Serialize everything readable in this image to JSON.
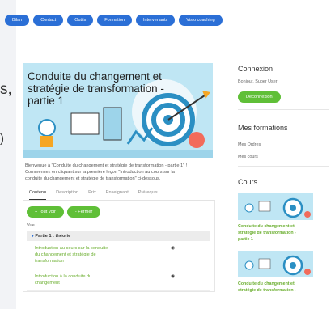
{
  "nav": {
    "items": [
      {
        "label": "Bilan"
      },
      {
        "label": "Contact"
      },
      {
        "label": "Outils"
      },
      {
        "label": "Formation"
      },
      {
        "label": "Intervenants"
      },
      {
        "label": "Visio coaching"
      }
    ]
  },
  "left_fragments": {
    "a": "s,",
    "b": ")"
  },
  "course": {
    "title_line1": "Conduite du changement et",
    "title_line2": "stratégie de transformation -",
    "title_line3": "partie 1",
    "desc_line1": "Bienvenue à \"Conduite du changement et stratégie de transformation - partie 1\" !",
    "desc_line2": "Commencez en cliquant sur la première leçon \"Introduction au cours sur la",
    "desc_line3": "conduite du changement et stratégie de transformation\" ci-dessous."
  },
  "tabs": [
    {
      "label": "Contenu",
      "active": true
    },
    {
      "label": "Description"
    },
    {
      "label": "Prix"
    },
    {
      "label": "Enseignant"
    },
    {
      "label": "Prérequis"
    }
  ],
  "buttons": {
    "expand": "+ Tout voir",
    "collapse": "- Fermer"
  },
  "panel": {
    "vue_label": "Vue",
    "part_caret": "▾",
    "part_title": "Partie 1 : théorie",
    "lessons": [
      {
        "l1": "Introduction au cours sur la conduite",
        "l2": "du changement et stratégie de",
        "l3": "transformation",
        "icon": "◉"
      },
      {
        "l1": "Introduction à la conduite du",
        "l2": "changement",
        "l3": "",
        "icon": "◉"
      }
    ]
  },
  "sidebar": {
    "connexion_title": "Connexion",
    "welcome": "Bonjour, Super User",
    "logout": "Déconnexion",
    "formations_title": "Mes formations",
    "orders": "Mes Ordres",
    "courses": "Mes cours",
    "cours_title": "Cours",
    "course_items": [
      {
        "l1": "Conduite du changement et",
        "l2": "stratégie de transformation -",
        "l3": "partie 1"
      },
      {
        "l1": "Conduite du changement et",
        "l2": "stratégie de transformation -",
        "l3": ""
      }
    ]
  },
  "colors": {
    "nav": "#2b6fd6",
    "green": "#5fbf37",
    "link_green": "#6aae2e",
    "hero_bg": "#bfe6f4"
  }
}
